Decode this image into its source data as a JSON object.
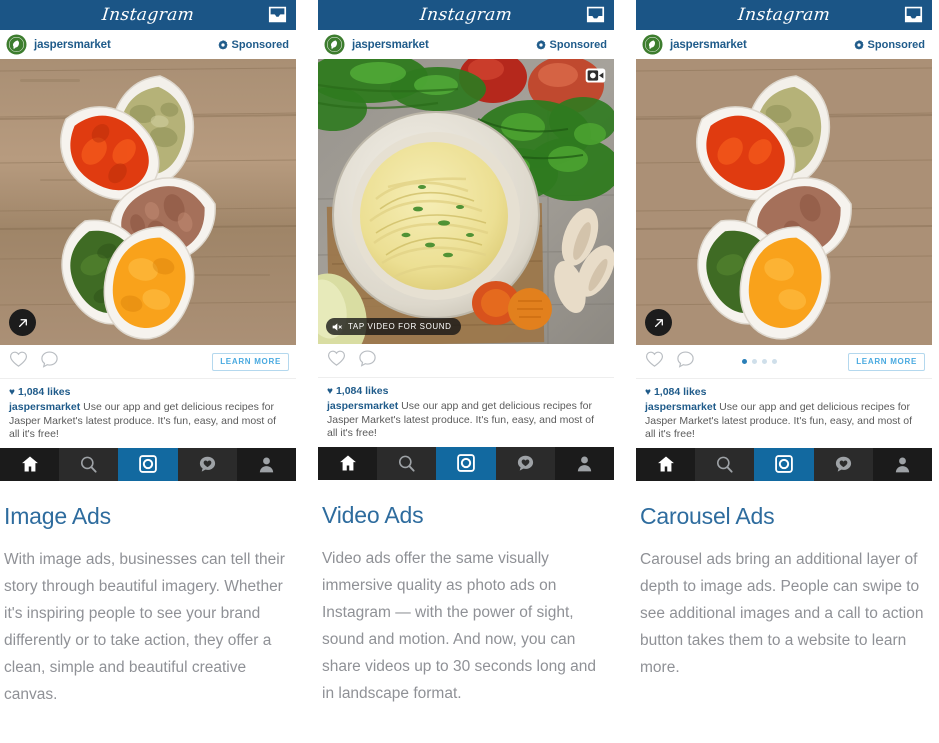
{
  "columns": [
    {
      "key": "image_ads",
      "ad": {
        "app_name": "Instagram",
        "inbox_icon": "inbox-icon",
        "advertiser": "jaspersmarket",
        "sponsored_label": "Sponsored",
        "sponsored_icon": "gear-icon",
        "media_type": "photo",
        "media_alt": "Five teardrop bowls of colorful spices on a wooden table",
        "share_icon": "arrow-up-right-icon",
        "has_share_badge": true,
        "has_video_badge": false,
        "video_badge_label": "",
        "like_icon": "heart-outline-icon",
        "comment_icon": "comment-bubble-icon",
        "cta_label": "LEARN MORE",
        "has_cta": true,
        "has_dots": false,
        "dots_total": 0,
        "dots_active": 0,
        "likes_text": "1,084 likes",
        "caption_author": "jaspersmarket",
        "caption_text": "Use our app and get delicious recipes for Jasper Market's latest produce. It's fun, easy, and most of all it's free!",
        "nav": [
          {
            "name": "home-icon",
            "label": "Home",
            "state": "active"
          },
          {
            "name": "search-icon",
            "label": "Search",
            "state": "default"
          },
          {
            "name": "camera-icon",
            "label": "Camera",
            "state": "highlighted"
          },
          {
            "name": "activity-heart-icon",
            "label": "Activity",
            "state": "default"
          },
          {
            "name": "profile-icon",
            "label": "Profile",
            "state": "default"
          }
        ]
      },
      "text": {
        "title": "Image Ads",
        "body": "With image ads, businesses can tell their story through beautiful imagery. Whether it's inspiring people to see your brand differently or to take action, they offer a clean, simple and beautiful creative canvas."
      }
    },
    {
      "key": "video_ads",
      "ad": {
        "app_name": "Instagram",
        "inbox_icon": "inbox-icon",
        "advertiser": "jaspersmarket",
        "sponsored_label": "Sponsored",
        "sponsored_icon": "gear-icon",
        "media_type": "video",
        "media_alt": "Bowl of spaghetti with herbs on a wooden board with parsley, tomatoes and garlic",
        "share_icon": "",
        "has_share_badge": false,
        "has_video_badge": true,
        "video_badge_label": "TAP VIDEO FOR SOUND",
        "video_badge_icon": "muted-speaker-icon",
        "video_corner_icon": "video-camera-icon",
        "like_icon": "heart-outline-icon",
        "comment_icon": "comment-bubble-icon",
        "cta_label": "",
        "has_cta": false,
        "has_dots": false,
        "dots_total": 0,
        "dots_active": 0,
        "likes_text": "1,084 likes",
        "caption_author": "jaspersmarket",
        "caption_text": "Use our app and get delicious recipes for Jasper Market's latest produce. It's fun, easy, and most of all it's free!",
        "nav": [
          {
            "name": "home-icon",
            "label": "Home",
            "state": "active"
          },
          {
            "name": "search-icon",
            "label": "Search",
            "state": "default"
          },
          {
            "name": "camera-icon",
            "label": "Camera",
            "state": "highlighted"
          },
          {
            "name": "activity-heart-icon",
            "label": "Activity",
            "state": "default"
          },
          {
            "name": "profile-icon",
            "label": "Profile",
            "state": "default"
          }
        ]
      },
      "text": {
        "title": "Video Ads",
        "body": "Video ads offer the same visually immersive quality as photo ads on Instagram — with the power of sight, sound and motion. And now, you can share videos up to 30 seconds long and in landscape format."
      }
    },
    {
      "key": "carousel_ads",
      "ad": {
        "app_name": "Instagram",
        "inbox_icon": "inbox-icon",
        "advertiser": "jaspersmarket",
        "sponsored_label": "Sponsored",
        "sponsored_icon": "gear-icon",
        "media_type": "photo",
        "media_alt": "Five teardrop bowls of colorful spices on a wooden table",
        "share_icon": "arrow-up-right-icon",
        "has_share_badge": true,
        "has_video_badge": false,
        "video_badge_label": "",
        "like_icon": "heart-outline-icon",
        "comment_icon": "comment-bubble-icon",
        "cta_label": "LEARN MORE",
        "has_cta": true,
        "has_dots": true,
        "dots_total": 4,
        "dots_active": 1,
        "likes_text": "1,084 likes",
        "caption_author": "jaspersmarket",
        "caption_text": "Use our app and get delicious recipes for Jasper Market's latest produce. It's fun, easy, and most of all it's free!",
        "nav": [
          {
            "name": "home-icon",
            "label": "Home",
            "state": "active"
          },
          {
            "name": "search-icon",
            "label": "Search",
            "state": "default"
          },
          {
            "name": "camera-icon",
            "label": "Camera",
            "state": "highlighted"
          },
          {
            "name": "activity-heart-icon",
            "label": "Activity",
            "state": "default"
          },
          {
            "name": "profile-icon",
            "label": "Profile",
            "state": "default"
          }
        ]
      },
      "text": {
        "title": "Carousel Ads",
        "body": "Carousel ads bring an additional layer of depth to image ads. People can swipe to see additional images and a call to action button takes them to a website to learn more."
      }
    }
  ],
  "colors": {
    "header_blue": "#1b5586",
    "brand_blue": "#1f5b8a",
    "cta_blue": "#4aaae0",
    "title_blue": "#2e6c9e",
    "body_gray": "#8f9196",
    "nav_dark": "#1b1b1b",
    "nav_active_blue": "#1269a0",
    "logo_green": "#3d7d2e"
  }
}
